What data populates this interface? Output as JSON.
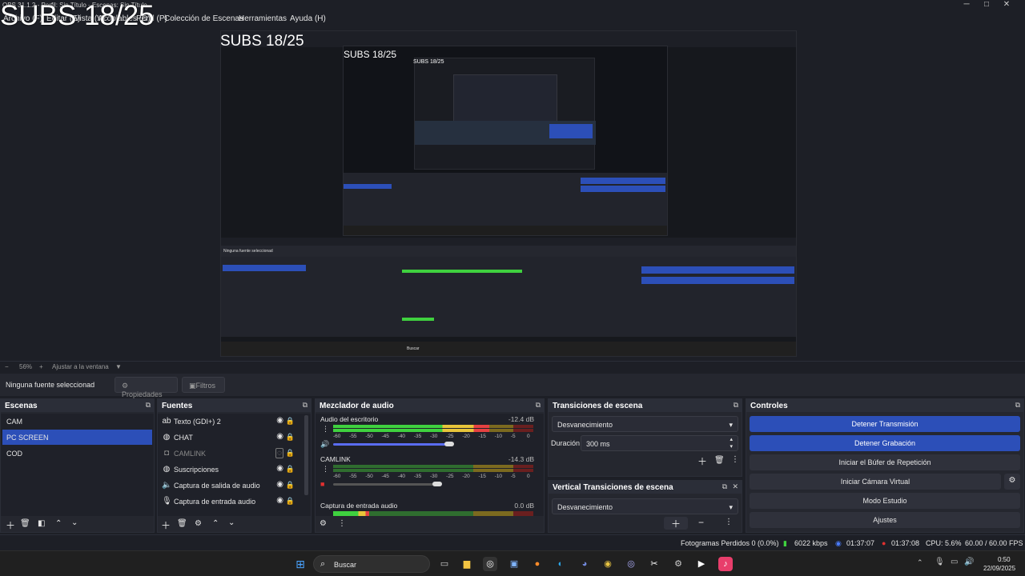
{
  "window": {
    "title": "OBS 31.1.2 - Perfil: Sin Título - Escenas: Sin Título",
    "minimize": "─",
    "maximize": "□",
    "close": "✕"
  },
  "overlay": {
    "subs": "SUBS 18/25"
  },
  "menu": [
    "Archivo (F)",
    "Editar (E)",
    "Vista (V)",
    "Acoplables (D)",
    "Perfil (P)",
    "Colección de Escenas",
    "Herramientas",
    "Ayuda (H)"
  ],
  "zoom": {
    "minus": "−",
    "value": "56%",
    "plus": "+",
    "fit": "Ajustar a la ventana",
    "arrow": "▼"
  },
  "props": {
    "selected": "Ninguna fuente seleccionad",
    "properties": "Propiedades",
    "filters": "Filtros"
  },
  "scenes": {
    "title": "Escenas",
    "items": [
      "CAM",
      "PC SCREEN",
      "COD"
    ],
    "selected": 1
  },
  "sources": {
    "title": "Fuentes",
    "items": [
      {
        "label": "Texto (GDI+) 2",
        "icon": "text-icon"
      },
      {
        "label": "CHAT",
        "icon": "browser-icon"
      },
      {
        "label": "CAMLINK",
        "icon": "camera-icon",
        "dim": true
      },
      {
        "label": "Suscripciones",
        "icon": "browser-icon"
      },
      {
        "label": "Captura de salida de audio",
        "icon": "speaker-icon"
      },
      {
        "label": "Captura de entrada audio",
        "icon": "microphone-icon"
      }
    ]
  },
  "mixer": {
    "title": "Mezclador de audio",
    "scale": [
      "-60",
      "-55",
      "-50",
      "-45",
      "-40",
      "-35",
      "-30",
      "-25",
      "-20",
      "-15",
      "-10",
      "-5",
      "0"
    ],
    "channels": [
      {
        "name": "Audio del escritorio",
        "db": "-12.4 dB",
        "level": 0.78,
        "volume": 0.58
      },
      {
        "name": "CAMLINK",
        "db": "-14.3 dB",
        "level": 0.0,
        "volume": 0.52
      },
      {
        "name": "Captura de entrada audio",
        "db": "0.0 dB",
        "level": 0.18,
        "volume": 0.5
      }
    ]
  },
  "transitions": {
    "title": "Transiciones de escena",
    "type": "Desvanecimiento",
    "duration_label": "Duración",
    "duration": "300 ms"
  },
  "vtransitions": {
    "title": "Vertical Transiciones de escena",
    "type": "Desvanecimiento"
  },
  "controls": {
    "title": "Controles",
    "buttons": [
      "Detener Transmisión",
      "Detener Grabación",
      "Iniciar el Búfer de Repetición",
      "Iniciar Cámara Virtual",
      "Modo Estudio",
      "Ajustes"
    ]
  },
  "status": {
    "dropped": "Fotogramas Perdidos 0 (0.0%)",
    "kbps": "6022 kbps",
    "stream_time": "01:37:07",
    "rec_time": "01:37:08",
    "cpu": "CPU: 5.6%",
    "fps": "60.00 / 60.00 FPS"
  },
  "taskbar": {
    "search": "Buscar",
    "time": "0:50",
    "date": "22/09/2025"
  },
  "colors": {
    "accent": "#2c4fb8",
    "bg": "#1d1f26",
    "panel": "#25272f"
  }
}
